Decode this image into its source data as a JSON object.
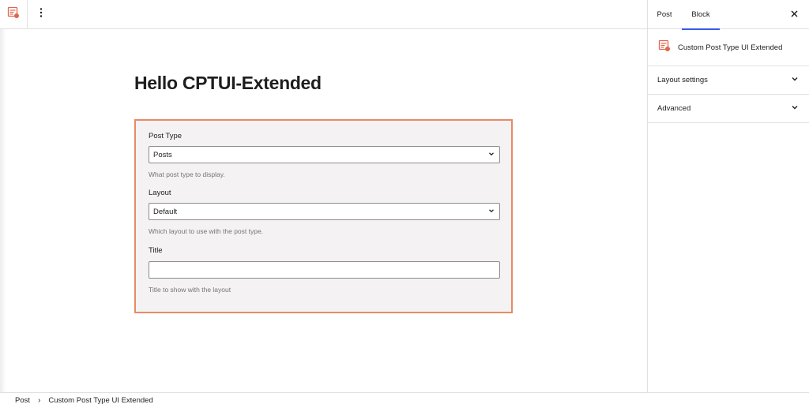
{
  "toolbar": {
    "block_icon": "custom-post-type-block-icon",
    "options_icon": "vertical-ellipsis-icon"
  },
  "sidebar": {
    "tabs": [
      {
        "label": "Post"
      },
      {
        "label": "Block"
      }
    ],
    "active_tab": "Block",
    "block_card": {
      "title": "Custom Post Type UI Extended"
    },
    "panels": [
      {
        "label": "Layout settings"
      },
      {
        "label": "Advanced"
      }
    ]
  },
  "canvas": {
    "post_title": "Hello CPTUI-Extended",
    "block": {
      "post_type": {
        "label": "Post Type",
        "value": "Posts",
        "help": "What post type to display."
      },
      "layout": {
        "label": "Layout",
        "value": "Default",
        "help": "Which layout to use with the post type."
      },
      "title": {
        "label": "Title",
        "value": "",
        "help": "Title to show with the layout"
      }
    }
  },
  "breadcrumb": {
    "items": [
      "Post",
      "Custom Post Type UI Extended"
    ],
    "separator": "›"
  },
  "colors": {
    "accent": "#3858e9",
    "block_border": "#e98a65",
    "block_icon": "#e0664a"
  }
}
